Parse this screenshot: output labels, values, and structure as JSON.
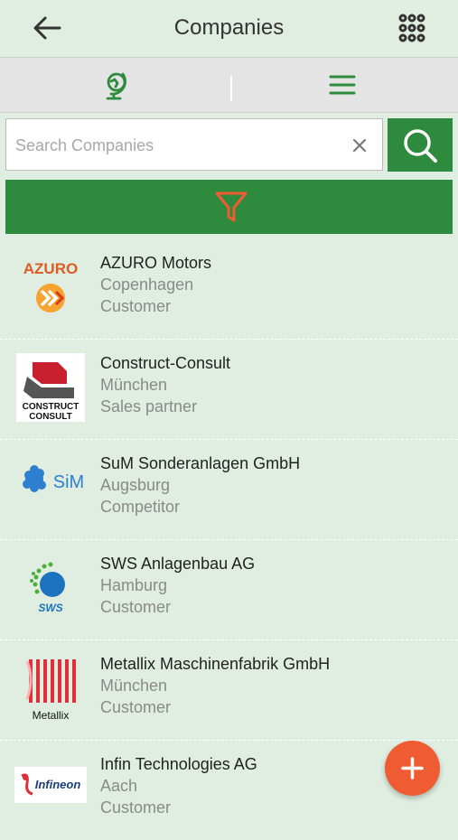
{
  "header": {
    "title": "Companies"
  },
  "tabs": [
    {
      "name": "map-view",
      "icon": "globe-icon"
    },
    {
      "name": "list-view",
      "icon": "list-icon"
    }
  ],
  "search": {
    "placeholder": "Search Companies",
    "value": ""
  },
  "colors": {
    "accent": "#2e8b3d",
    "fab": "#ef5b32",
    "filter_icon": "#ef5b32",
    "background": "#dfeee0"
  },
  "companies": [
    {
      "name": "AZURO Motors",
      "city": "Copenhagen",
      "type": "Customer",
      "logo": "azuro-logo",
      "logo_text": "AZURO"
    },
    {
      "name": "Construct-Consult",
      "city": "München",
      "type": "Sales partner",
      "logo": "construct-consult-logo",
      "logo_text": "CONSTRUCT CONSULT"
    },
    {
      "name": "SuM Sonderanlagen GmbH",
      "city": "Augsburg",
      "type": "Competitor",
      "logo": "sum-logo",
      "logo_text": "SiM"
    },
    {
      "name": "SWS Anlagenbau AG",
      "city": "Hamburg",
      "type": "Customer",
      "logo": "sws-logo",
      "logo_text": "SWS"
    },
    {
      "name": "Metallix Maschinenfabrik GmbH",
      "city": "München",
      "type": "Customer",
      "logo": "metallix-logo",
      "logo_text": "Metallix"
    },
    {
      "name": "Infin Technologies AG",
      "city": "Aach",
      "type": "Customer",
      "logo": "infineon-logo",
      "logo_text": "Infineon"
    }
  ]
}
